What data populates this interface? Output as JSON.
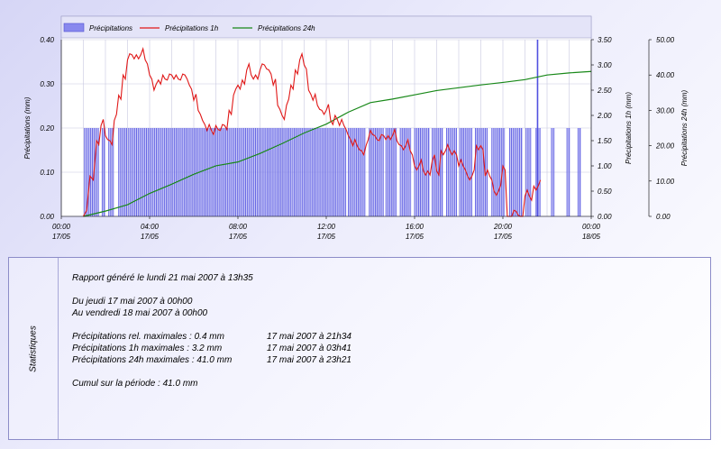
{
  "chart_data": {
    "type": "bar",
    "legend": [
      {
        "name": "Précipitations",
        "color": "#8080e8"
      },
      {
        "name": "Précipitations 1h",
        "color": "#e01818"
      },
      {
        "name": "Précipitations 24h",
        "color": "#188818"
      }
    ],
    "x_axis": {
      "range_hours": [
        0,
        24
      ],
      "tick_labels": [
        {
          "time": "00:00",
          "date": "17/05"
        },
        {
          "time": "04:00",
          "date": "17/05"
        },
        {
          "time": "08:00",
          "date": "17/05"
        },
        {
          "time": "12:00",
          "date": "17/05"
        },
        {
          "time": "16:00",
          "date": "17/05"
        },
        {
          "time": "20:00",
          "date": "17/05"
        },
        {
          "time": "00:00",
          "date": "18/05"
        }
      ]
    },
    "y_left": {
      "label": "Précipitations (mm)",
      "range": [
        0,
        0.4
      ],
      "ticks": [
        "0.00",
        "0.10",
        "0.20",
        "0.30",
        "0.40"
      ]
    },
    "y_right1": {
      "label": "Précipitations 1h (mm)",
      "range": [
        0,
        3.5
      ],
      "ticks": [
        "0.00",
        "0.50",
        "1.00",
        "1.50",
        "2.00",
        "2.50",
        "3.00",
        "3.50"
      ]
    },
    "y_right2": {
      "label": "Précipitations 24h (mm)",
      "range": [
        0,
        50
      ],
      "ticks": [
        "0.00",
        "10.00",
        "20.00",
        "30.00",
        "40.00",
        "50.00"
      ]
    },
    "bars": {
      "series": "Précipitations",
      "value_mm": 0.2,
      "peak": {
        "hour": 21.57,
        "value_mm": 0.4
      },
      "active_intervals_hours": [
        [
          1.05,
          1.7
        ],
        [
          1.85,
          2.0
        ],
        [
          2.15,
          2.4
        ],
        [
          2.6,
          3.0
        ],
        [
          3.05,
          9.0
        ],
        [
          9.05,
          10.5
        ],
        [
          10.55,
          12.9
        ],
        [
          13.0,
          13.8
        ],
        [
          13.95,
          14.6
        ],
        [
          14.7,
          15.2
        ],
        [
          15.35,
          15.85
        ],
        [
          16.0,
          16.7
        ],
        [
          16.8,
          17.3
        ],
        [
          17.45,
          17.9
        ],
        [
          18.05,
          18.6
        ],
        [
          18.75,
          19.3
        ],
        [
          19.5,
          20.1
        ],
        [
          20.3,
          20.9
        ],
        [
          21.05,
          21.3
        ],
        [
          21.5,
          21.7
        ],
        [
          22.2,
          22.35
        ],
        [
          22.9,
          23.05
        ],
        [
          23.4,
          23.55
        ]
      ]
    },
    "line_1h": {
      "series": "Précipitations 1h",
      "x_hours": [
        1.0,
        1.3,
        1.6,
        1.8,
        2.0,
        2.2,
        2.4,
        2.6,
        2.8,
        3.0,
        3.2,
        3.4,
        3.6,
        3.8,
        4.0,
        4.2,
        4.4,
        4.6,
        4.8,
        5.0,
        5.2,
        5.4,
        5.6,
        5.8,
        6.0,
        6.2,
        6.4,
        6.6,
        6.8,
        7.0,
        7.2,
        7.4,
        7.6,
        7.8,
        8.0,
        8.2,
        8.4,
        8.6,
        8.8,
        9.0,
        9.2,
        9.4,
        9.6,
        9.8,
        10.0,
        10.2,
        10.4,
        10.6,
        10.8,
        11.0,
        11.2,
        11.4,
        11.6,
        11.8,
        12.0,
        12.2,
        12.4,
        12.6,
        12.8,
        13.0,
        13.2,
        13.4,
        13.6,
        13.8,
        14.0,
        14.2,
        14.4,
        14.6,
        14.8,
        15.0,
        15.2,
        15.4,
        15.6,
        15.8,
        16.0,
        16.2,
        16.4,
        16.6,
        16.8,
        17.0,
        17.2,
        17.4,
        17.6,
        17.8,
        18.0,
        18.2,
        18.4,
        18.6,
        18.8,
        19.0,
        19.2,
        19.4,
        19.6,
        19.8,
        20.0,
        20.2,
        20.4,
        20.6,
        20.8,
        21.0,
        21.2,
        21.4,
        21.6,
        21.8,
        22.0,
        22.2,
        22.4,
        22.6,
        22.8,
        23.0,
        23.2,
        23.4,
        23.6,
        23.8,
        24.0
      ],
      "values": [
        0.0,
        0.8,
        1.5,
        1.8,
        1.6,
        1.5,
        1.9,
        2.4,
        2.8,
        3.1,
        3.2,
        3.2,
        3.2,
        3.1,
        2.8,
        2.5,
        2.7,
        2.8,
        2.7,
        2.8,
        2.8,
        2.7,
        2.8,
        2.6,
        2.3,
        2.1,
        1.9,
        1.7,
        1.7,
        1.8,
        1.7,
        1.8,
        2.1,
        2.4,
        2.6,
        2.7,
        2.9,
        2.8,
        2.8,
        2.9,
        3.0,
        2.9,
        2.6,
        2.2,
        2.0,
        2.2,
        2.6,
        2.9,
        3.1,
        3.0,
        2.5,
        2.3,
        2.2,
        2.1,
        2.1,
        1.9,
        2.0,
        1.8,
        1.8,
        1.6,
        1.4,
        1.4,
        1.3,
        1.4,
        1.7,
        1.6,
        1.5,
        1.6,
        1.6,
        1.6,
        1.5,
        1.4,
        1.4,
        1.3,
        1.0,
        1.0,
        0.9,
        0.9,
        1.1,
        0.9,
        1.3,
        1.3,
        1.3,
        1.3,
        1.0,
        1.0,
        0.8,
        0.8,
        1.4,
        1.4,
        0.8,
        0.8,
        0.5,
        0.5,
        1.0,
        0.0,
        0.0,
        0.1,
        0.0,
        0.4,
        0.4,
        0.6,
        0.6
      ],
      "max_label": 3.2
    },
    "line_24h": {
      "series": "Précipitations 24h",
      "x_hours": [
        1.0,
        2.0,
        3.0,
        4.0,
        5.0,
        6.0,
        7.0,
        8.0,
        9.0,
        10.0,
        11.0,
        12.0,
        13.0,
        14.0,
        15.0,
        16.0,
        17.0,
        18.0,
        19.0,
        20.0,
        21.0,
        22.0,
        23.0,
        24.0
      ],
      "values": [
        0.0,
        1.5,
        3.3,
        6.5,
        9.1,
        11.9,
        14.3,
        15.4,
        17.8,
        20.6,
        23.6,
        26.1,
        29.5,
        32.2,
        33.2,
        34.4,
        35.6,
        36.4,
        37.2,
        37.9,
        38.7,
        40.0,
        40.6,
        41.0
      ]
    }
  },
  "stats": {
    "panel_label": "Statistiques",
    "report_line": "Rapport généré le lundi 21 mai 2007 à 13h35",
    "period_from": "Du jeudi 17 mai 2007 à 00h00",
    "period_to": "Au vendredi 18 mai 2007 à 00h00",
    "rows": [
      {
        "label": "Précipitations rel. maximales : 0.4 mm",
        "when": "17 mai 2007 à 21h34"
      },
      {
        "label": "Précipitations 1h maximales : 3.2 mm",
        "when": "17 mai 2007 à 03h41"
      },
      {
        "label": "Précipitations 24h maximales : 41.0 mm",
        "when": "17 mai 2007 à 23h21"
      }
    ],
    "cumul": "Cumul sur la période : 41.0 mm"
  }
}
